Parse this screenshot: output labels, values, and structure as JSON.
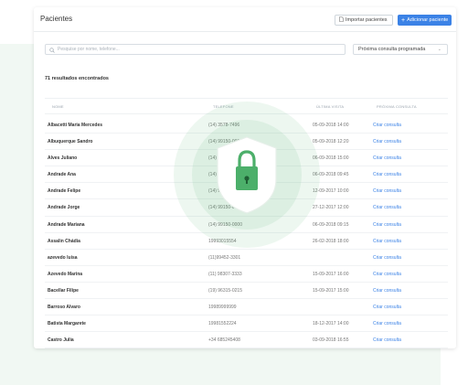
{
  "page": {
    "title": "Pacientes"
  },
  "toolbar": {
    "import_label": "Importar pacientes",
    "add_label": "Adicionar paciente",
    "add_icon": "+"
  },
  "search": {
    "placeholder": "Pesquise por nome, telefone..."
  },
  "filter": {
    "selected": "Próxima consulta programada"
  },
  "results": {
    "text": "71 resultados encontrados"
  },
  "table": {
    "headers": {
      "name": "NOME",
      "phone": "TELEFONE",
      "last": "ÚLTIMA VISITA",
      "next": "PRÓXIMA CONSULTA"
    },
    "rows": [
      {
        "name": "Albacetti Maria Mercedes",
        "phone": "(14) 3578-7496",
        "last": "05-09-2018 14:00",
        "next": "Criar consulta"
      },
      {
        "name": "Albuquerque Sandro",
        "phone": "(14) 99150-0000",
        "last": "05-09-2018 12:20",
        "next": "Criar consulta"
      },
      {
        "name": "Alves Juliano",
        "phone": "(14) 99150-0000",
        "last": "06-09-2018 15:00",
        "next": "Criar consulta"
      },
      {
        "name": "Andrade Ana",
        "phone": "(14) 99150-0000",
        "last": "06-09-2018 09:45",
        "next": "Criar consulta"
      },
      {
        "name": "Andrade Felipe",
        "phone": "(14) 99150-0000",
        "last": "12-09-2017 10:00",
        "next": "Criar consulta"
      },
      {
        "name": "Andrade Jorge",
        "phone": "(14) 99150-0000",
        "last": "27-12-2017 12:00",
        "next": "Criar consulta"
      },
      {
        "name": "Andrade Mariana",
        "phone": "(14) 99150-0000",
        "last": "06-09-2018 09:15",
        "next": "Criar consulta"
      },
      {
        "name": "Assalin Chádia",
        "phone": "19993015554",
        "last": "26-02-2018 18:00",
        "next": "Criar consulta"
      },
      {
        "name": "azevedo luisa",
        "phone": "(11)99452-3301",
        "last": "",
        "next": "Criar consulta"
      },
      {
        "name": "Azevedo Marina",
        "phone": "(11) 98307-3333",
        "last": "15-09-2017 16:00",
        "next": "Criar consulta"
      },
      {
        "name": "Bacellar Filipe",
        "phone": "(19) 96315-0215",
        "last": "15-09-2017 15:00",
        "next": "Criar consulta"
      },
      {
        "name": "Barroso Alvaro",
        "phone": "19989999999",
        "last": "",
        "next": "Criar consulta"
      },
      {
        "name": "Batista Margarete",
        "phone": "19981552224",
        "last": "18-12-2017 14:00",
        "next": "Criar consulta"
      },
      {
        "name": "Castro Julia",
        "phone": "+34 685245408",
        "last": "03-09-2018 16:55",
        "next": "Criar consulta"
      }
    ]
  },
  "colors": {
    "accent": "#3b82e6",
    "lock_green": "#4caf6a",
    "bg_green": "#f1f8f3"
  },
  "icons": {
    "import": "document-icon",
    "search": "search-icon",
    "lock": "lock-icon",
    "shield": "shield-icon"
  }
}
